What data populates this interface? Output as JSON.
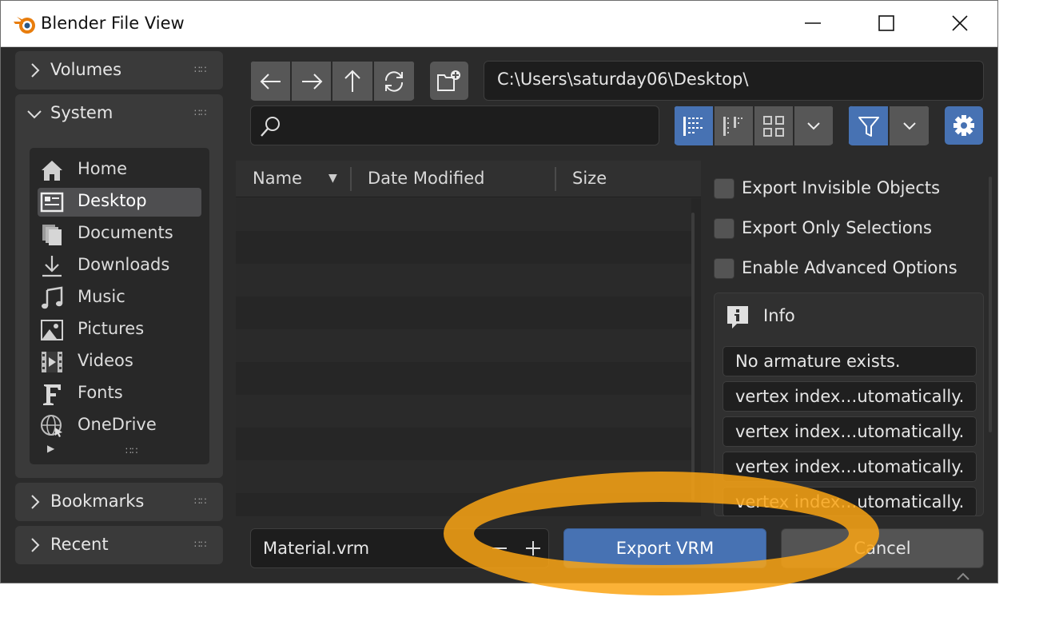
{
  "window": {
    "title": "Blender File View",
    "minimize_icon": "minimize-icon",
    "maximize_icon": "maximize-icon",
    "close_icon": "close-icon"
  },
  "sidebar": {
    "volumes": {
      "label": "Volumes"
    },
    "system": {
      "label": "System",
      "items": [
        {
          "label": "Home",
          "icon": "home-icon"
        },
        {
          "label": "Desktop",
          "icon": "desktop-icon",
          "active": true
        },
        {
          "label": "Documents",
          "icon": "documents-icon"
        },
        {
          "label": "Downloads",
          "icon": "download-icon"
        },
        {
          "label": "Music",
          "icon": "music-icon"
        },
        {
          "label": "Pictures",
          "icon": "pictures-icon"
        },
        {
          "label": "Videos",
          "icon": "videos-icon"
        },
        {
          "label": "Fonts",
          "icon": "fonts-icon"
        },
        {
          "label": "OneDrive",
          "icon": "globe-icon"
        }
      ]
    },
    "bookmarks": {
      "label": "Bookmarks"
    },
    "recent": {
      "label": "Recent"
    }
  },
  "toolbar": {
    "path": "C:\\Users\\saturday06\\Desktop\\",
    "search_value": ""
  },
  "file_list": {
    "columns": [
      "Name",
      "Date Modified",
      "Size"
    ]
  },
  "options": {
    "export_invisible": {
      "label": "Export Invisible Objects",
      "checked": false
    },
    "export_selected": {
      "label": "Export Only Selections",
      "checked": false
    },
    "advanced": {
      "label": "Enable Advanced Options",
      "checked": false
    }
  },
  "info": {
    "title": "Info",
    "messages": [
      "No armature exists.",
      "vertex index…utomatically.",
      "vertex index…utomatically.",
      "vertex index…utomatically.",
      "vertex index…utomatically."
    ]
  },
  "bottom": {
    "filename": "Material.vrm",
    "export_label": "Export VRM",
    "cancel_label": "Cancel"
  },
  "colors": {
    "accent_blue": "#4772b3",
    "highlight_orange": "#faa514",
    "window_bg": "#2b2b2b"
  }
}
